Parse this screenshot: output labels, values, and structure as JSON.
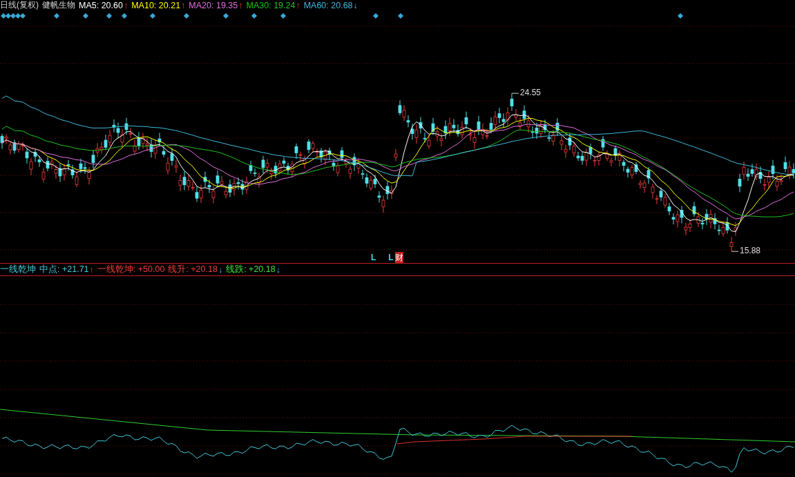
{
  "header": {
    "period": "日线(复权)",
    "stock": "健帆生物"
  },
  "moving_averages": [
    {
      "label": "MA5:",
      "value": "20.60",
      "arrow": "↑",
      "rising": true,
      "color": "#ffffff"
    },
    {
      "label": "MA10:",
      "value": "20.21",
      "arrow": "↑",
      "rising": true,
      "color": "#ffff00"
    },
    {
      "label": "MA20:",
      "value": "19.35",
      "arrow": "↑",
      "rising": true,
      "color": "#e070e0"
    },
    {
      "label": "MA30:",
      "value": "19.24",
      "arrow": "↑",
      "rising": true,
      "color": "#20c020"
    },
    {
      "label": "MA60:",
      "value": "20.68",
      "arrow": "↓",
      "rising": false,
      "color": "#40b8d8"
    }
  ],
  "price_labels": [
    {
      "kind": "high",
      "text": "24.55"
    },
    {
      "kind": "low",
      "text": "15.88"
    }
  ],
  "signals": [
    {
      "kind": "plain",
      "text": "L"
    },
    {
      "kind": "plain",
      "text": "L"
    },
    {
      "kind": "finance",
      "text": "财"
    }
  ],
  "indicator": {
    "items": [
      {
        "label": "一线乾坤",
        "color": "#40c8d8"
      },
      {
        "label": "中点:",
        "value": "+21.71",
        "arrow": "↑",
        "rising": true,
        "color": "#40c8d8"
      },
      {
        "label": "一线乾坤:",
        "value": "+50.00",
        "color": "#f03c3c"
      },
      {
        "label": "线升:",
        "value": "+20.18",
        "arrow": "↓",
        "rising": false,
        "color": "#f03c3c"
      },
      {
        "label": "线跌:",
        "value": "+20.18",
        "arrow": "↓",
        "rising": false,
        "color": "#40e040"
      }
    ]
  }
}
